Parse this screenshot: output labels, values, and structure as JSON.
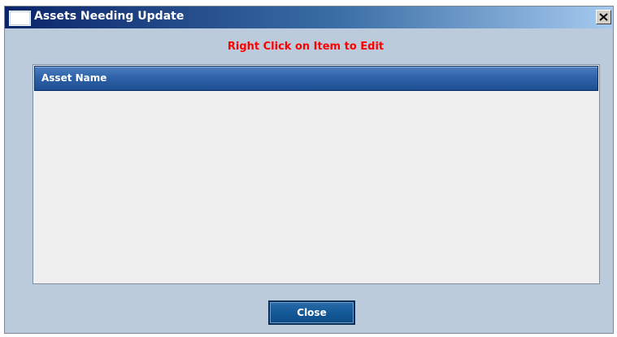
{
  "window": {
    "title": "Assets Needing Update",
    "close_symbol": "X"
  },
  "hint": {
    "text": "Right Click on Item to Edit",
    "color": "#ff0000"
  },
  "list": {
    "columns": [
      "Asset Name"
    ],
    "rows": []
  },
  "footer": {
    "close_label": "Close"
  },
  "colors": {
    "dialog_background": "#bccbdb",
    "header_blue": "#2f62a8",
    "button_blue": "#135a98",
    "list_background": "#efefef"
  },
  "icons": {
    "window_icon": "window-icon",
    "close_icon": "close-icon"
  }
}
